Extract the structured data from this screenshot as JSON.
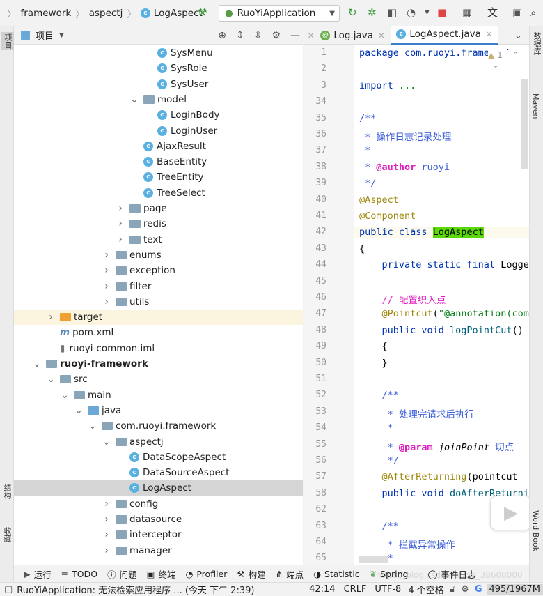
{
  "breadcrumb": [
    "framework",
    "aspectj",
    "LogAspect"
  ],
  "run_config": "RuoYiApplication",
  "project_panel": {
    "title": "项目"
  },
  "tree": [
    {
      "label": "SysMenu",
      "depth": 8,
      "type": "class"
    },
    {
      "label": "SysRole",
      "depth": 8,
      "type": "class"
    },
    {
      "label": "SysUser",
      "depth": 8,
      "type": "class"
    },
    {
      "label": "model",
      "depth": 7,
      "type": "package",
      "expanded": true
    },
    {
      "label": "LoginBody",
      "depth": 8,
      "type": "class"
    },
    {
      "label": "LoginUser",
      "depth": 8,
      "type": "class"
    },
    {
      "label": "AjaxResult",
      "depth": 7,
      "type": "class"
    },
    {
      "label": "BaseEntity",
      "depth": 7,
      "type": "class"
    },
    {
      "label": "TreeEntity",
      "depth": 7,
      "type": "class"
    },
    {
      "label": "TreeSelect",
      "depth": 7,
      "type": "class"
    },
    {
      "label": "page",
      "depth": 6,
      "type": "package",
      "expanded": false
    },
    {
      "label": "redis",
      "depth": 6,
      "type": "package",
      "expanded": false
    },
    {
      "label": "text",
      "depth": 6,
      "type": "package",
      "expanded": false
    },
    {
      "label": "enums",
      "depth": 5,
      "type": "package",
      "expanded": false
    },
    {
      "label": "exception",
      "depth": 5,
      "type": "package",
      "expanded": false
    },
    {
      "label": "filter",
      "depth": 5,
      "type": "package",
      "expanded": false
    },
    {
      "label": "utils",
      "depth": 5,
      "type": "package",
      "expanded": false
    },
    {
      "label": "target",
      "depth": 1,
      "type": "target",
      "expanded": false
    },
    {
      "label": "pom.xml",
      "depth": 1,
      "type": "maven"
    },
    {
      "label": "ruoyi-common.iml",
      "depth": 1,
      "type": "iml"
    },
    {
      "label": "ruoyi-framework",
      "depth": 0,
      "type": "module",
      "expanded": true
    },
    {
      "label": "src",
      "depth": 1,
      "type": "package",
      "expanded": true
    },
    {
      "label": "main",
      "depth": 2,
      "type": "package",
      "expanded": true
    },
    {
      "label": "java",
      "depth": 3,
      "type": "source",
      "expanded": true
    },
    {
      "label": "com.ruoyi.framework",
      "depth": 4,
      "type": "package",
      "expanded": true
    },
    {
      "label": "aspectj",
      "depth": 5,
      "type": "package",
      "expanded": true
    },
    {
      "label": "DataScopeAspect",
      "depth": 6,
      "type": "class"
    },
    {
      "label": "DataSourceAspect",
      "depth": 6,
      "type": "class"
    },
    {
      "label": "LogAspect",
      "depth": 6,
      "type": "class",
      "selected": true
    },
    {
      "label": "config",
      "depth": 5,
      "type": "package",
      "expanded": false
    },
    {
      "label": "datasource",
      "depth": 5,
      "type": "package",
      "expanded": false
    },
    {
      "label": "interceptor",
      "depth": 5,
      "type": "package",
      "expanded": false
    },
    {
      "label": "manager",
      "depth": 5,
      "type": "package",
      "expanded": false
    }
  ],
  "editor_tabs": [
    {
      "label": "Log.java",
      "icon": "annotation"
    },
    {
      "label": "LogAspect.java",
      "icon": "class",
      "active": true
    }
  ],
  "inspection": {
    "warnings": "1"
  },
  "code": [
    {
      "n": "1",
      "t": [
        [
          "kw",
          "package com.ruoyi.framework.aspectj;"
        ]
      ]
    },
    {
      "n": "2",
      "t": []
    },
    {
      "n": "3",
      "t": [
        [
          "kw",
          "import "
        ],
        [
          "str",
          "..."
        ]
      ]
    },
    {
      "n": "34",
      "t": []
    },
    {
      "n": "35",
      "t": [
        [
          "cm",
          "/**"
        ]
      ]
    },
    {
      "n": "36",
      "t": [
        [
          "cm",
          " * 操作日志记录处理"
        ]
      ]
    },
    {
      "n": "37",
      "t": [
        [
          "cm",
          " *"
        ]
      ]
    },
    {
      "n": "38",
      "t": [
        [
          "cm",
          " * "
        ],
        [
          "tag",
          "@author"
        ],
        [
          "cm",
          " ruoyi"
        ]
      ]
    },
    {
      "n": "39",
      "t": [
        [
          "cm",
          " */"
        ]
      ]
    },
    {
      "n": "40",
      "t": [
        [
          "an",
          "@Aspect"
        ]
      ]
    },
    {
      "n": "41",
      "t": [
        [
          "an",
          "@Component"
        ]
      ]
    },
    {
      "n": "42",
      "t": [
        [
          "kw",
          "public class "
        ],
        [
          "hl",
          "LogAspect"
        ]
      ]
    },
    {
      "n": "43",
      "t": [
        [
          "id",
          "{"
        ]
      ]
    },
    {
      "n": "44",
      "t": [
        [
          "kw",
          "    private static final "
        ],
        [
          "id",
          "Logger log"
        ]
      ]
    },
    {
      "n": "45",
      "t": []
    },
    {
      "n": "46",
      "t": [
        [
          "lc",
          "    // 配置织入点"
        ]
      ]
    },
    {
      "n": "47",
      "t": [
        [
          "an",
          "    @Pointcut"
        ],
        [
          "id",
          "("
        ],
        [
          "str",
          "\"@annotation(com.ruoyi"
        ]
      ]
    },
    {
      "n": "48",
      "t": [
        [
          "kw",
          "    public void "
        ],
        [
          "fn",
          "logPointCut"
        ],
        [
          "id",
          "()"
        ]
      ]
    },
    {
      "n": "49",
      "t": [
        [
          "id",
          "    {"
        ]
      ]
    },
    {
      "n": "50",
      "t": [
        [
          "id",
          "    }"
        ]
      ]
    },
    {
      "n": "51",
      "t": []
    },
    {
      "n": "52",
      "t": [
        [
          "cm",
          "    /**"
        ]
      ]
    },
    {
      "n": "53",
      "t": [
        [
          "cm",
          "     * 处理完请求后执行"
        ]
      ]
    },
    {
      "n": "54",
      "t": [
        [
          "cm",
          "     *"
        ]
      ]
    },
    {
      "n": "55",
      "t": [
        [
          "cm",
          "     * "
        ],
        [
          "tag",
          "@param"
        ],
        [
          "it",
          " joinPoint"
        ],
        [
          "cm",
          " 切点"
        ]
      ]
    },
    {
      "n": "56",
      "t": [
        [
          "cm",
          "     */"
        ]
      ]
    },
    {
      "n": "57",
      "t": [
        [
          "an",
          "    @AfterReturning"
        ],
        [
          "id",
          "(pointcut"
        ]
      ]
    },
    {
      "n": "58",
      "t": [
        [
          "kw",
          "    public void "
        ],
        [
          "fn",
          "doAfterReturning"
        ]
      ]
    },
    {
      "n": "62",
      "t": []
    },
    {
      "n": "63",
      "t": [
        [
          "cm",
          "    /**"
        ]
      ]
    },
    {
      "n": "64",
      "t": [
        [
          "cm",
          "     * 拦截异常操作"
        ]
      ]
    },
    {
      "n": "65",
      "t": [
        [
          "cm",
          "     *"
        ]
      ]
    }
  ],
  "left_strip": {
    "top": "项目",
    "structure": "结构",
    "favorites": "收藏"
  },
  "right_strip": [
    "数据库",
    "Maven",
    "Word Book"
  ],
  "tool_windows": [
    "运行",
    "TODO",
    "问题",
    "终端",
    "Profiler",
    "构建",
    "端点",
    "Statistic",
    "Spring",
    "事件日志"
  ],
  "status": {
    "message": "RuoYiApplication: 无法检索应用程序 ... (今天 下午 2:39)",
    "position": "42:14",
    "line_sep": "CRLF",
    "encoding": "UTF-8",
    "indent": "4 个空格",
    "memory": "495/1967M"
  },
  "watermark": "https://blog.csdn.net/qq_38608000"
}
